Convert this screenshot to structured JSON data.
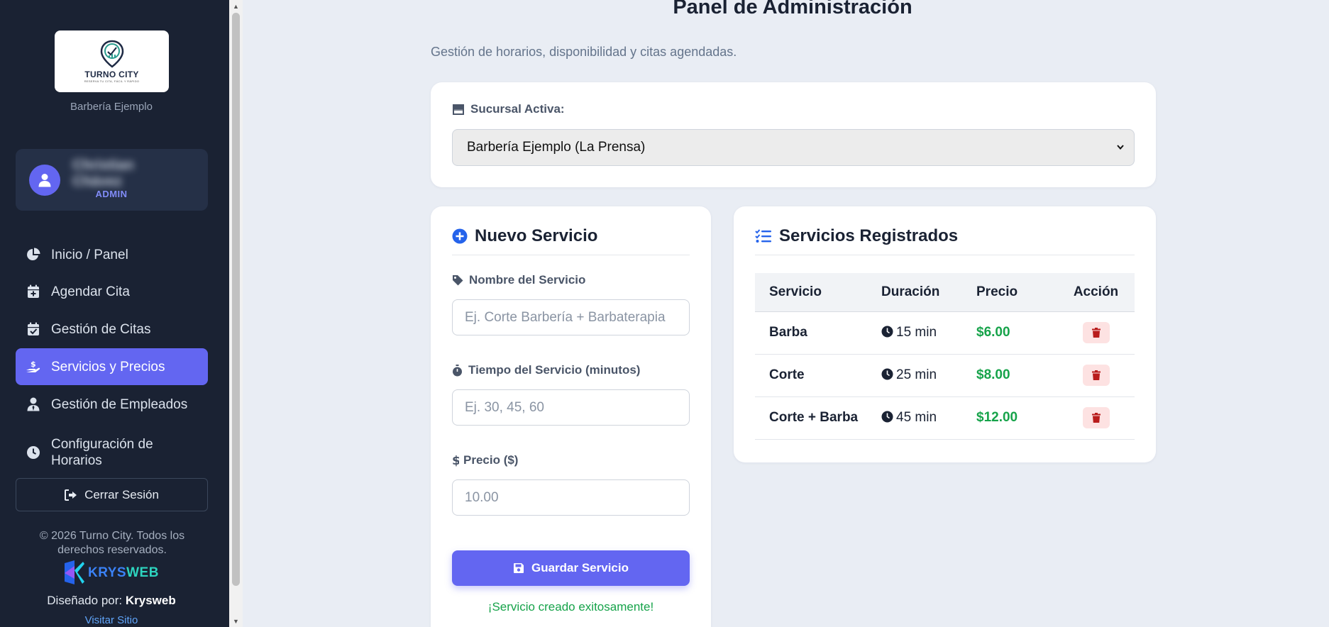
{
  "sidebar": {
    "logo": {
      "brand": "TURNO CITY",
      "tagline": "RESERVA TU CITA, FÁCIL Y RÁPIDO"
    },
    "branch_name": "Barbería Ejemplo",
    "user": {
      "name": "Christian Chávez",
      "role": "ADMIN"
    },
    "nav": [
      {
        "label": "Inicio / Panel",
        "icon": "pie-chart-icon",
        "active": false
      },
      {
        "label": "Agendar Cita",
        "icon": "calendar-plus-icon",
        "active": false
      },
      {
        "label": "Gestión de Citas",
        "icon": "calendar-check-icon",
        "active": false
      },
      {
        "label": "Servicios y Precios",
        "icon": "hand-holding-dollar-icon",
        "active": true
      },
      {
        "label": "Gestión de Empleados",
        "icon": "user-tie-icon",
        "active": false
      },
      {
        "label": "Configuración de Horarios",
        "icon": "clock-icon",
        "active": false
      }
    ],
    "logout_label": "Cerrar Sesión",
    "copyright": "© 2026 Turno City. Todos los derechos reservados.",
    "krysweb_logo": {
      "part1": "KRYS",
      "part2": "WEB"
    },
    "designed_prefix": "Diseñado por:",
    "designed_by": "Krysweb",
    "visit_link": "Visitar Sitio"
  },
  "main": {
    "title": "Panel de Administración",
    "subtitle": "Gestión de horarios, disponibilidad y citas agendadas.",
    "branch": {
      "label": "Sucursal Activa:",
      "selected": "Barbería Ejemplo (La Prensa)"
    },
    "new_service": {
      "title": "Nuevo Servicio",
      "name_label": "Nombre del Servicio",
      "name_placeholder": "Ej. Corte Barbería + Barbaterapia",
      "time_label": "Tiempo del Servicio (minutos)",
      "time_placeholder": "Ej. 30, 45, 60",
      "price_label": "Precio ($)",
      "price_placeholder": "10.00",
      "save_label": "Guardar Servicio",
      "success_message": "¡Servicio creado exitosamente!"
    },
    "services": {
      "title": "Servicios Registrados",
      "headers": [
        "Servicio",
        "Duración",
        "Precio",
        "Acción"
      ],
      "rows": [
        {
          "name": "Barba",
          "duration": "15 min",
          "price": "$6.00"
        },
        {
          "name": "Corte",
          "duration": "25 min",
          "price": "$8.00"
        },
        {
          "name": "Corte + Barba",
          "duration": "45 min",
          "price": "$12.00"
        }
      ]
    }
  },
  "colors": {
    "sidebar_bg": "#1a2233",
    "accent": "#6366f1",
    "price_green": "#16a34a",
    "danger": "#b91c1c",
    "page_bg": "#e9edf4"
  }
}
